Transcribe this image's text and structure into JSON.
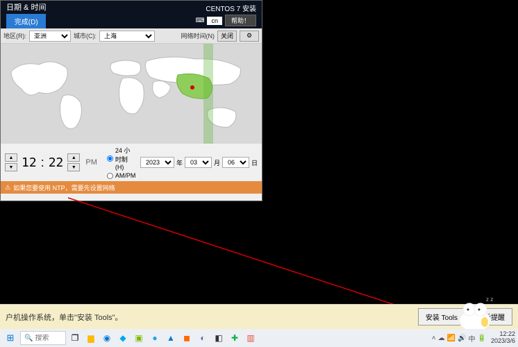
{
  "installer": {
    "title": "日期 & 时间",
    "done": "完成(D)",
    "product": "CENTOS 7 安装",
    "keyboard": "cn",
    "help": "帮助！",
    "filters": {
      "region_label": "地区(R):",
      "region_value": "亚洲",
      "city_label": "城市(C):",
      "city_value": "上海",
      "nettime_label": "网络时间(N)",
      "nettime_btn": "关闭"
    },
    "time": {
      "hour": "12",
      "minute": "22",
      "ampm": "PM",
      "fmt24": "24 小时制(H)",
      "fmtAmPm": "AM/PM"
    },
    "date": {
      "year": "2023",
      "year_lbl": "年",
      "month": "03",
      "month_lbl": "月",
      "day": "06",
      "day_lbl": "日"
    },
    "warning": "如果您要使用 NTP，需要先设置网络"
  },
  "vmware": {
    "message": "户机操作系统，单击\"安装 Tools\"。",
    "install": "安装 Tools",
    "later": "以后提醒"
  },
  "taskbar": {
    "search_placeholder": "搜索",
    "clock_time": "12:22",
    "clock_date": "2023/3/6"
  },
  "icons": {
    "c1": "#0078d4",
    "c2": "#ffb900",
    "c3": "#00a4ef",
    "c4": "#7fba00",
    "c5": "#1da1f2",
    "c6": "#0078d4",
    "c7": "#ff6a00",
    "c8": "#6264a7",
    "c9": "#333333",
    "c10": "#0db04b",
    "c11": "#e74c3c"
  }
}
